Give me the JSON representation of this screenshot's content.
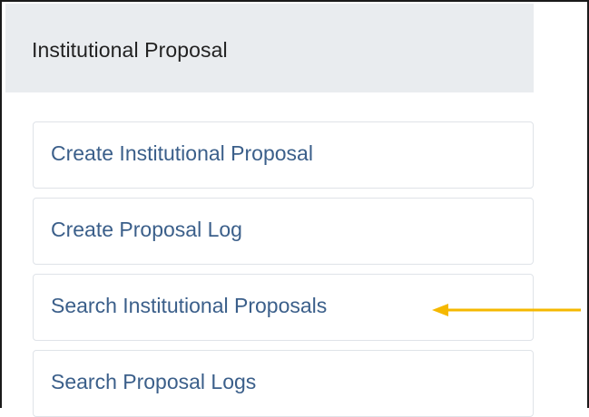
{
  "panel": {
    "title": "Institutional Proposal",
    "items": [
      {
        "label": "Create Institutional Proposal"
      },
      {
        "label": "Create Proposal Log"
      },
      {
        "label": "Search Institutional Proposals"
      },
      {
        "label": "Search Proposal Logs"
      }
    ]
  },
  "annotation": {
    "icon": "left-arrow-icon",
    "color": "#f5b800"
  },
  "colors": {
    "header_bg": "#e9ecef",
    "link_text": "#3b5f8a",
    "item_border": "#dfe3e8"
  }
}
